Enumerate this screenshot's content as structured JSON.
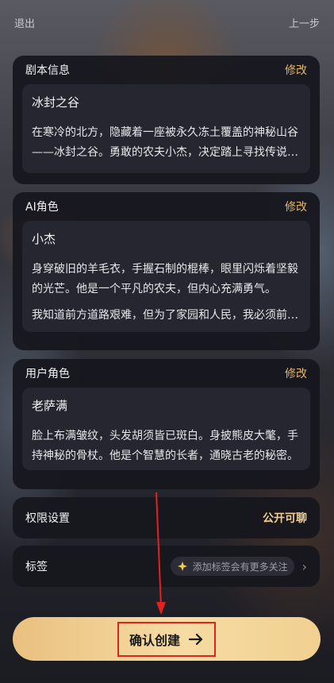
{
  "topbar": {
    "exit_label": "退出",
    "prev_label": "上一步"
  },
  "script_card": {
    "title": "剧本信息",
    "edit_label": "修改",
    "name": "冰封之谷",
    "description": "在寒冷的北方，隐藏着一座被永久冻土覆盖的神秘山谷——冰封之谷。勇敢的农夫小杰，决定踏上寻找传说中宝藏的旅程。"
  },
  "ai_card": {
    "title": "AI角色",
    "edit_label": "修改",
    "name": "小杰",
    "description": "身穿破旧的羊毛衣，手握石制的棍棒，眼里闪烁着坚毅的光芒。他是一个平凡的农夫，但内心充满勇气。",
    "greeting": "我知道前方道路艰难，但为了家园和人民，我必须前进。"
  },
  "user_card": {
    "title": "用户角色",
    "edit_label": "修改",
    "name": "老萨满",
    "description": "脸上布满皱纹，头发胡须皆已斑白。身披熊皮大氅，手持神秘的骨杖。他是个智慧的长者，通晓古老的秘密。"
  },
  "permission": {
    "label": "权限设置",
    "value": "公开可聊"
  },
  "tags": {
    "label": "标签",
    "hint": "添加标签会有更多关注"
  },
  "confirm": {
    "label": "确认创建"
  },
  "colors": {
    "accent": "#e4b767",
    "button_gold": "#f1d091",
    "annotation_red": "#e3221e"
  }
}
